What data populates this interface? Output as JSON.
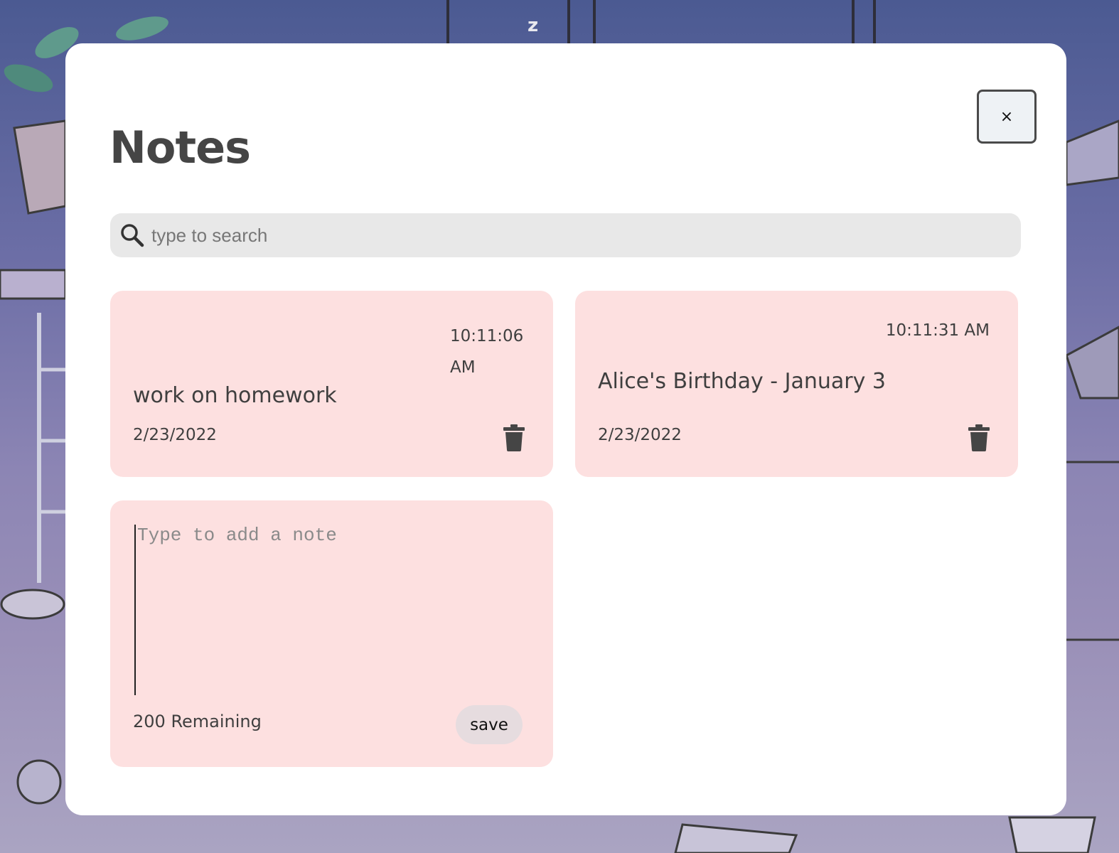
{
  "app": {
    "title": "Notes"
  },
  "close_button": {
    "label": "×"
  },
  "search": {
    "placeholder": "type to search",
    "value": ""
  },
  "notes": [
    {
      "time": "10:11:06 AM",
      "text": "work on homework",
      "date": "2/23/2022"
    },
    {
      "time": "10:11:31 AM",
      "text": "Alice's Birthday - January 3",
      "date": "2/23/2022"
    }
  ],
  "new_note": {
    "placeholder": "Type to add a note",
    "remaining": "200 Remaining",
    "save_label": "save"
  },
  "icons": {
    "search": "search-icon",
    "delete": "trash-icon",
    "close": "close-icon"
  },
  "colors": {
    "note_background": "#fde0e0",
    "modal_background": "#ffffff",
    "search_background": "#e8e8e8",
    "text": "#3f3f3f"
  }
}
